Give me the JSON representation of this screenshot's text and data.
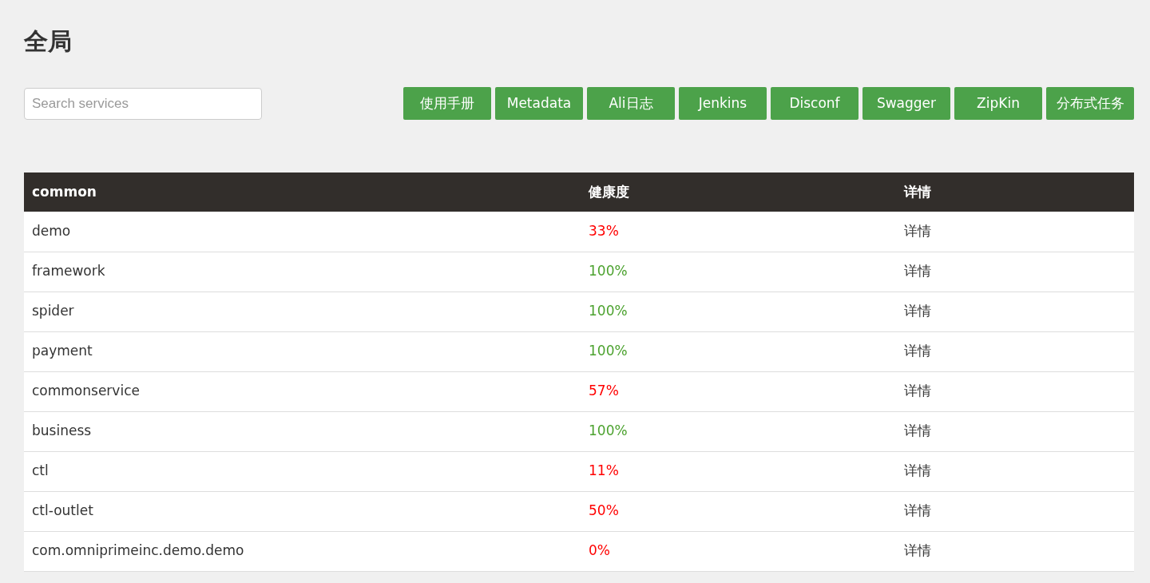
{
  "title": "全局",
  "search": {
    "placeholder": "Search services"
  },
  "buttons": [
    "使用手册",
    "Metadata",
    "Ali日志",
    "Jenkins",
    "Disconf",
    "Swagger",
    "ZipKin",
    "分布式任务"
  ],
  "table": {
    "columns": [
      "common",
      "健康度",
      "详情"
    ],
    "rows": [
      {
        "name": "demo",
        "health": "33%",
        "color": "#ff0000",
        "details": "详情"
      },
      {
        "name": "framework",
        "health": "100%",
        "color": "#4ca22f",
        "details": "详情"
      },
      {
        "name": "spider",
        "health": "100%",
        "color": "#4ca22f",
        "details": "详情"
      },
      {
        "name": "payment",
        "health": "100%",
        "color": "#4ca22f",
        "details": "详情"
      },
      {
        "name": "commonservice",
        "health": "57%",
        "color": "#ff0000",
        "details": "详情"
      },
      {
        "name": "business",
        "health": "100%",
        "color": "#4ca22f",
        "details": "详情"
      },
      {
        "name": "ctl",
        "health": "11%",
        "color": "#ff0000",
        "details": "详情"
      },
      {
        "name": "ctl-outlet",
        "health": "50%",
        "color": "#ff0000",
        "details": "详情"
      },
      {
        "name": "com.omniprimeinc.demo.demo",
        "health": "0%",
        "color": "#ff0000",
        "details": "详情"
      }
    ]
  }
}
